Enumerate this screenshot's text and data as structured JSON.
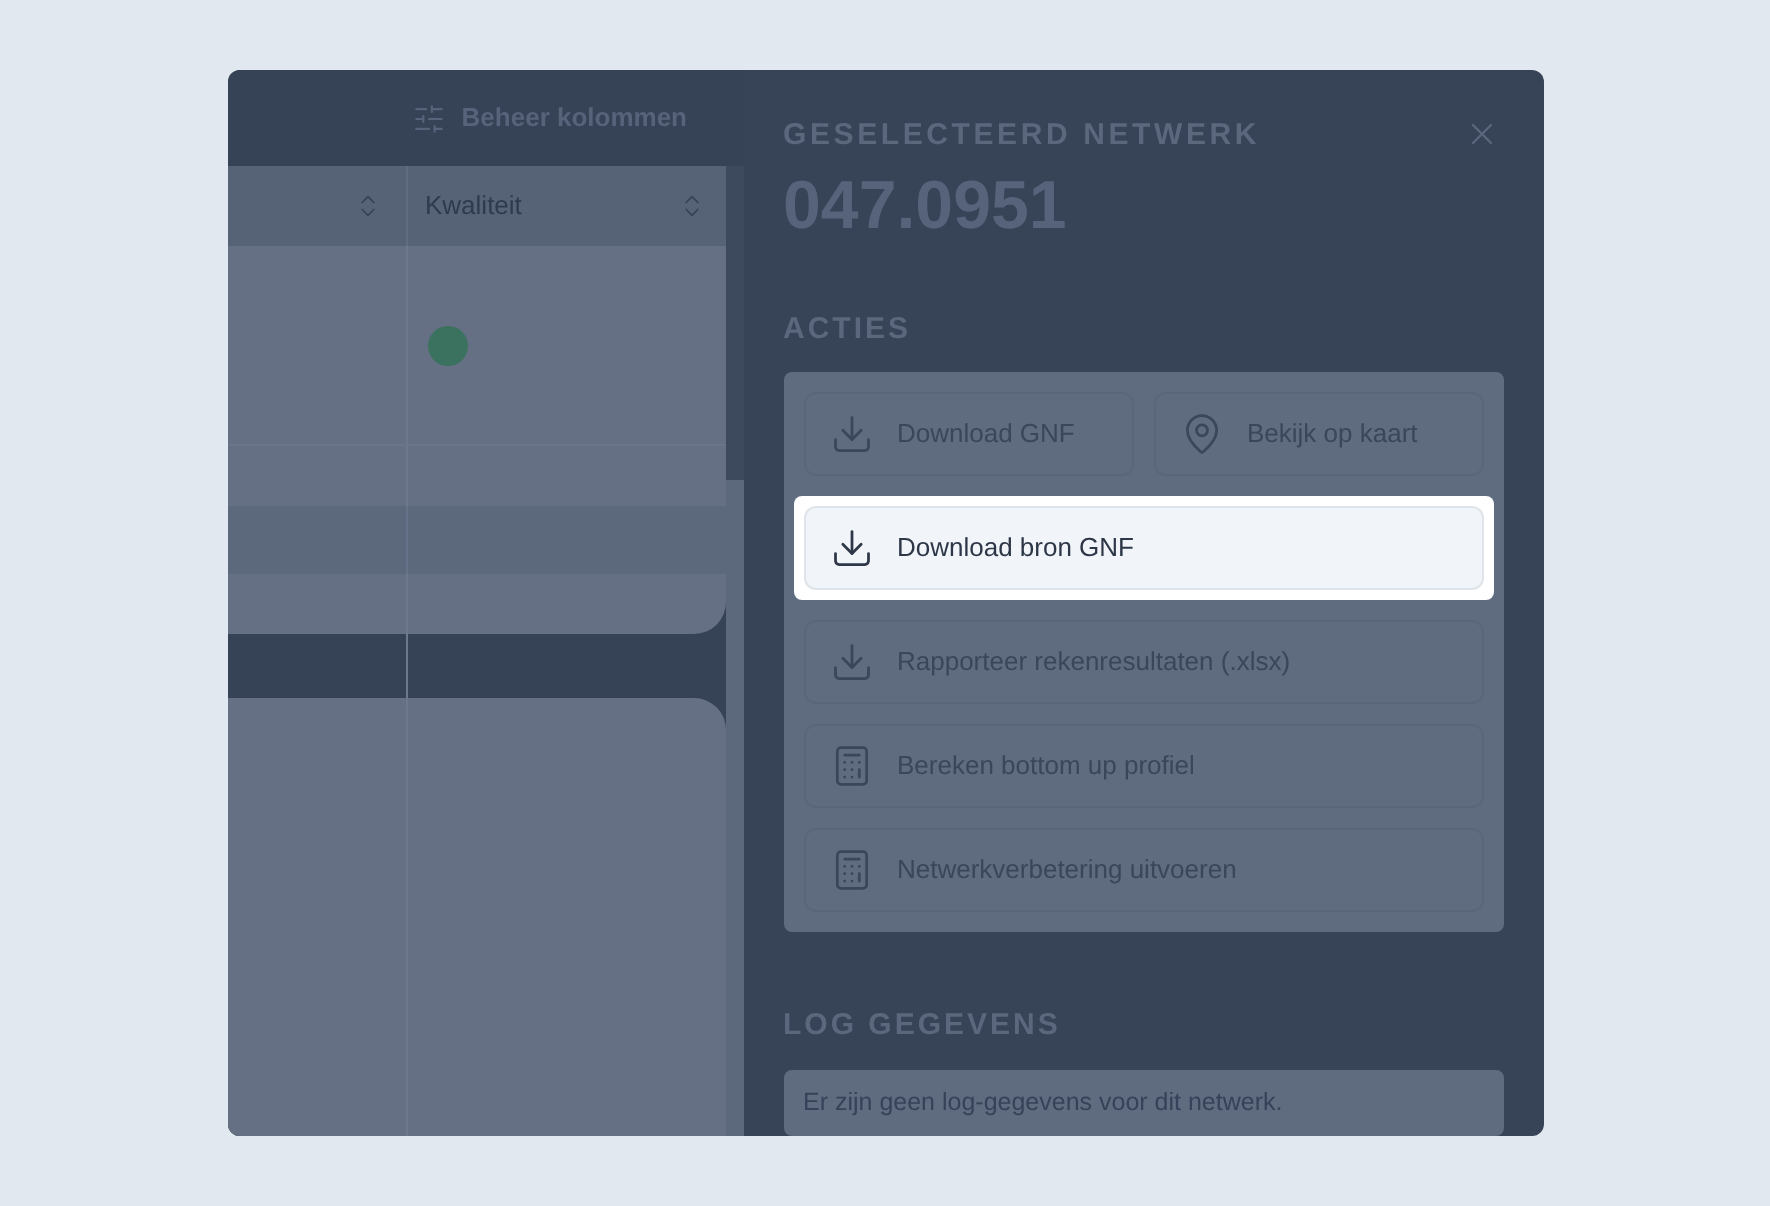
{
  "toolbar": {
    "manage_columns": "Beheer kolommen"
  },
  "table": {
    "column_2_header": "Kwaliteit",
    "status_dot": {
      "color": "#3b715f"
    }
  },
  "panel": {
    "heading": "GESELECTEERD NETWERK",
    "network_id": "047.0951",
    "actions_heading": "ACTIES",
    "actions": [
      {
        "label": "Download GNF",
        "kind": "download",
        "highlighted": false
      },
      {
        "label": "Bekijk op kaart",
        "kind": "map",
        "highlighted": false
      },
      {
        "label": "Download bron GNF",
        "kind": "download",
        "highlighted": true
      },
      {
        "label": "Rapporteer rekenresultaten (.xlsx)",
        "kind": "download",
        "highlighted": false
      },
      {
        "label": "Bereken bottom up profiel",
        "kind": "calculation",
        "highlighted": false
      },
      {
        "label": "Netwerkverbetering uitvoeren",
        "kind": "calculation",
        "highlighted": false
      }
    ],
    "log_heading": "LOG GEGEVENS",
    "log_message": "Er zijn geen log-gegevens voor dit netwerk."
  }
}
